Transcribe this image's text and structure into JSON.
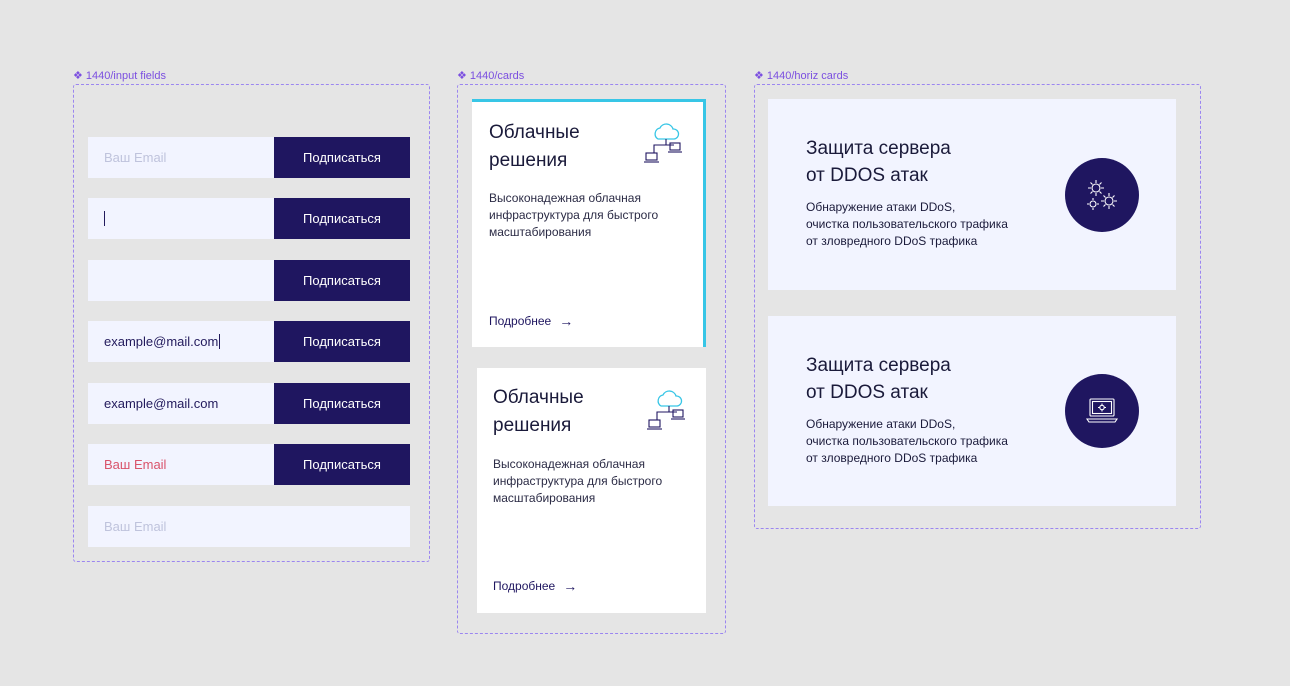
{
  "frames": {
    "inputs": {
      "label": "1440/input fields",
      "glyph": "❖"
    },
    "cards": {
      "label": "1440/cards",
      "glyph": "❖"
    },
    "horiz": {
      "label": "1440/horiz cards",
      "glyph": "❖"
    }
  },
  "inputs": {
    "button_label": "Подписаться",
    "rows": [
      {
        "value": "Ваш Email",
        "state": "placeholder"
      },
      {
        "value": "",
        "state": "focused"
      },
      {
        "value": "",
        "state": "empty"
      },
      {
        "value": "example@mail.com",
        "state": "typing"
      },
      {
        "value": "example@mail.com",
        "state": "filled"
      },
      {
        "value": "Ваш Email",
        "state": "error"
      },
      {
        "value": "Ваш Email",
        "state": "no-button"
      }
    ]
  },
  "cards": [
    {
      "title_line1": "Облачные",
      "title_line2": "решения",
      "desc_line1": "Высоконадежная облачная",
      "desc_line2": "инфраструктура для быстрого",
      "desc_line3": "масштабирования",
      "more": "Подробнее",
      "icon": "cloud-network-icon",
      "accent": "#38c6e6"
    },
    {
      "title_line1": "Облачные",
      "title_line2": "решения",
      "desc_line1": "Высоконадежная облачная",
      "desc_line2": "инфраструктура для быстрого",
      "desc_line3": "масштабирования",
      "more": "Подробнее",
      "icon": "cloud-network-icon"
    }
  ],
  "hcards": [
    {
      "title_line1": "Защита сервера",
      "title_line2": "от DDOS атак",
      "desc_line1": "Обнаружение атаки DDoS,",
      "desc_line2": "очистка пользовательского трафика",
      "desc_line3": "от зловредного DDoS трафика",
      "icon": "gears-icon"
    },
    {
      "title_line1": "Защита сервера",
      "title_line2": "от DDOS атак",
      "desc_line1": "Обнаружение атаки DDoS,",
      "desc_line2": "очистка пользовательского трафика",
      "desc_line3": "от зловредного DDoS трафика",
      "icon": "laptop-gear-icon"
    }
  ],
  "colors": {
    "primary": "#1f1660",
    "field_bg": "#f2f4ff",
    "error": "#d9536b",
    "frame": "#9b86f0"
  }
}
